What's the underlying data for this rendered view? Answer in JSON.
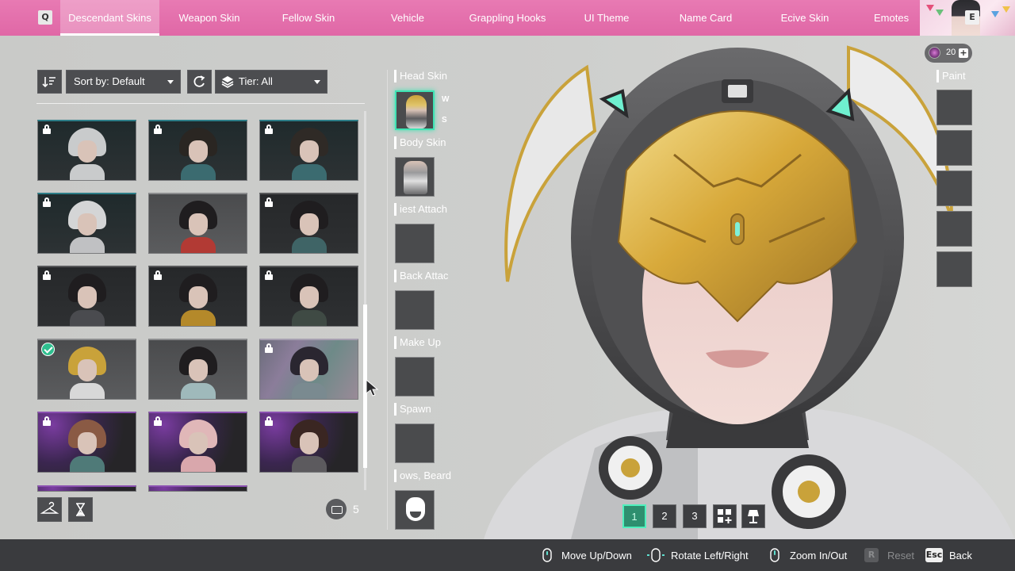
{
  "topbar": {
    "prev_key": "Q",
    "next_key": "E",
    "tabs": [
      {
        "label": "Descendant Skins",
        "active": true
      },
      {
        "label": "Weapon Skin",
        "active": false
      },
      {
        "label": "Fellow Skin",
        "active": false
      },
      {
        "label": "Vehicle",
        "active": false
      },
      {
        "label": "Grappling Hooks",
        "active": false
      },
      {
        "label": "UI Theme",
        "active": false
      },
      {
        "label": "Name Card",
        "active": false
      },
      {
        "label": "Ecive Skin",
        "active": false
      },
      {
        "label": "Emotes",
        "active": false
      }
    ]
  },
  "filters": {
    "sort_label": "Sort by: Default",
    "tier_label": "Tier: All"
  },
  "grid": {
    "skins": [
      {
        "frame": "teal",
        "locked": true,
        "equipped": false,
        "hair": "#c9cbcc",
        "body": "#c9cbcc"
      },
      {
        "frame": "teal",
        "locked": true,
        "equipped": false,
        "hair": "#2a2622",
        "body": "#3b6b70"
      },
      {
        "frame": "teal",
        "locked": true,
        "equipped": false,
        "hair": "#2f2a26",
        "body": "#3b6b70"
      },
      {
        "frame": "teal",
        "locked": true,
        "equipped": false,
        "hair": "#d4d5d6",
        "body": "#c0c1c3"
      },
      {
        "frame": "gray",
        "locked": false,
        "equipped": false,
        "hair": "#1f1d1f",
        "body": "#b23a34"
      },
      {
        "frame": "dark",
        "locked": true,
        "equipped": false,
        "hair": "#1f1d1f",
        "body": "#3f6466"
      },
      {
        "frame": "dark",
        "locked": true,
        "equipped": false,
        "hair": "#1f1d1f",
        "body": "#4a4b4f"
      },
      {
        "frame": "dark",
        "locked": true,
        "equipped": false,
        "hair": "#1f1d1f",
        "body": "#b4892a"
      },
      {
        "frame": "dark",
        "locked": true,
        "equipped": false,
        "hair": "#1f1d1f",
        "body": "#3f4a44"
      },
      {
        "frame": "gray",
        "locked": false,
        "equipped": true,
        "hair": "#c9a23a",
        "body": "#d8d8d8"
      },
      {
        "frame": "gray",
        "locked": false,
        "equipped": false,
        "hair": "#1f1d1f",
        "body": "#9fb9bb"
      },
      {
        "frame": "holo",
        "locked": true,
        "equipped": false,
        "hair": "#2a2630",
        "body": "#7a8a90"
      },
      {
        "frame": "purple",
        "locked": true,
        "equipped": false,
        "hair": "#8a5a44",
        "body": "#4f7a78"
      },
      {
        "frame": "purple",
        "locked": true,
        "equipped": false,
        "hair": "#e0b7b8",
        "body": "#d9a7ac"
      },
      {
        "frame": "purple",
        "locked": true,
        "equipped": false,
        "hair": "#3a2622",
        "body": "#5c5a5e"
      }
    ],
    "owned_count": "5"
  },
  "slots": {
    "head_label": "Head Skin",
    "body_label": "Body Skin",
    "chest_label": "iest Attach",
    "back_label": "Back Attac",
    "makeup_label": "Make Up",
    "spawn_label": "Spawn",
    "brows_label": "ows, Beard",
    "up_key": "W",
    "down_key": "S"
  },
  "right": {
    "paint_label": "Paint",
    "currency_amount": "20",
    "currency_plus": "+"
  },
  "presets": [
    "1",
    "2",
    "3"
  ],
  "bottombar": {
    "move": "Move Up/Down",
    "rotate": "Rotate Left/Right",
    "zoom": "Zoom In/Out",
    "reset_key": "R",
    "reset": "Reset",
    "back_key": "Esc",
    "back": "Back"
  },
  "colors": {
    "accent_pink": "#e067a6",
    "accent_green": "#3fe3b3",
    "panel": "#4a4b4d",
    "bottom_bar": "#3a3b3e"
  }
}
